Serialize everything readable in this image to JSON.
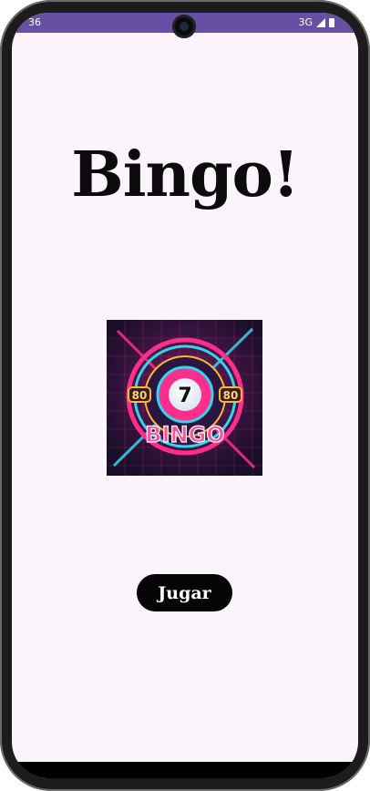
{
  "status_bar": {
    "time": "36",
    "network": "3G"
  },
  "main": {
    "title": "Bingo!",
    "image": {
      "center_number": "7",
      "left_badge": "80",
      "right_badge": "80",
      "logo_text": "BINGO"
    },
    "play_button_label": "Jugar"
  },
  "colors": {
    "status_bar": "#6750a4",
    "background": "#fcf4fc",
    "button": "#050505",
    "neon_pink": "#ff2e8a",
    "neon_cyan": "#2fd7f0"
  }
}
